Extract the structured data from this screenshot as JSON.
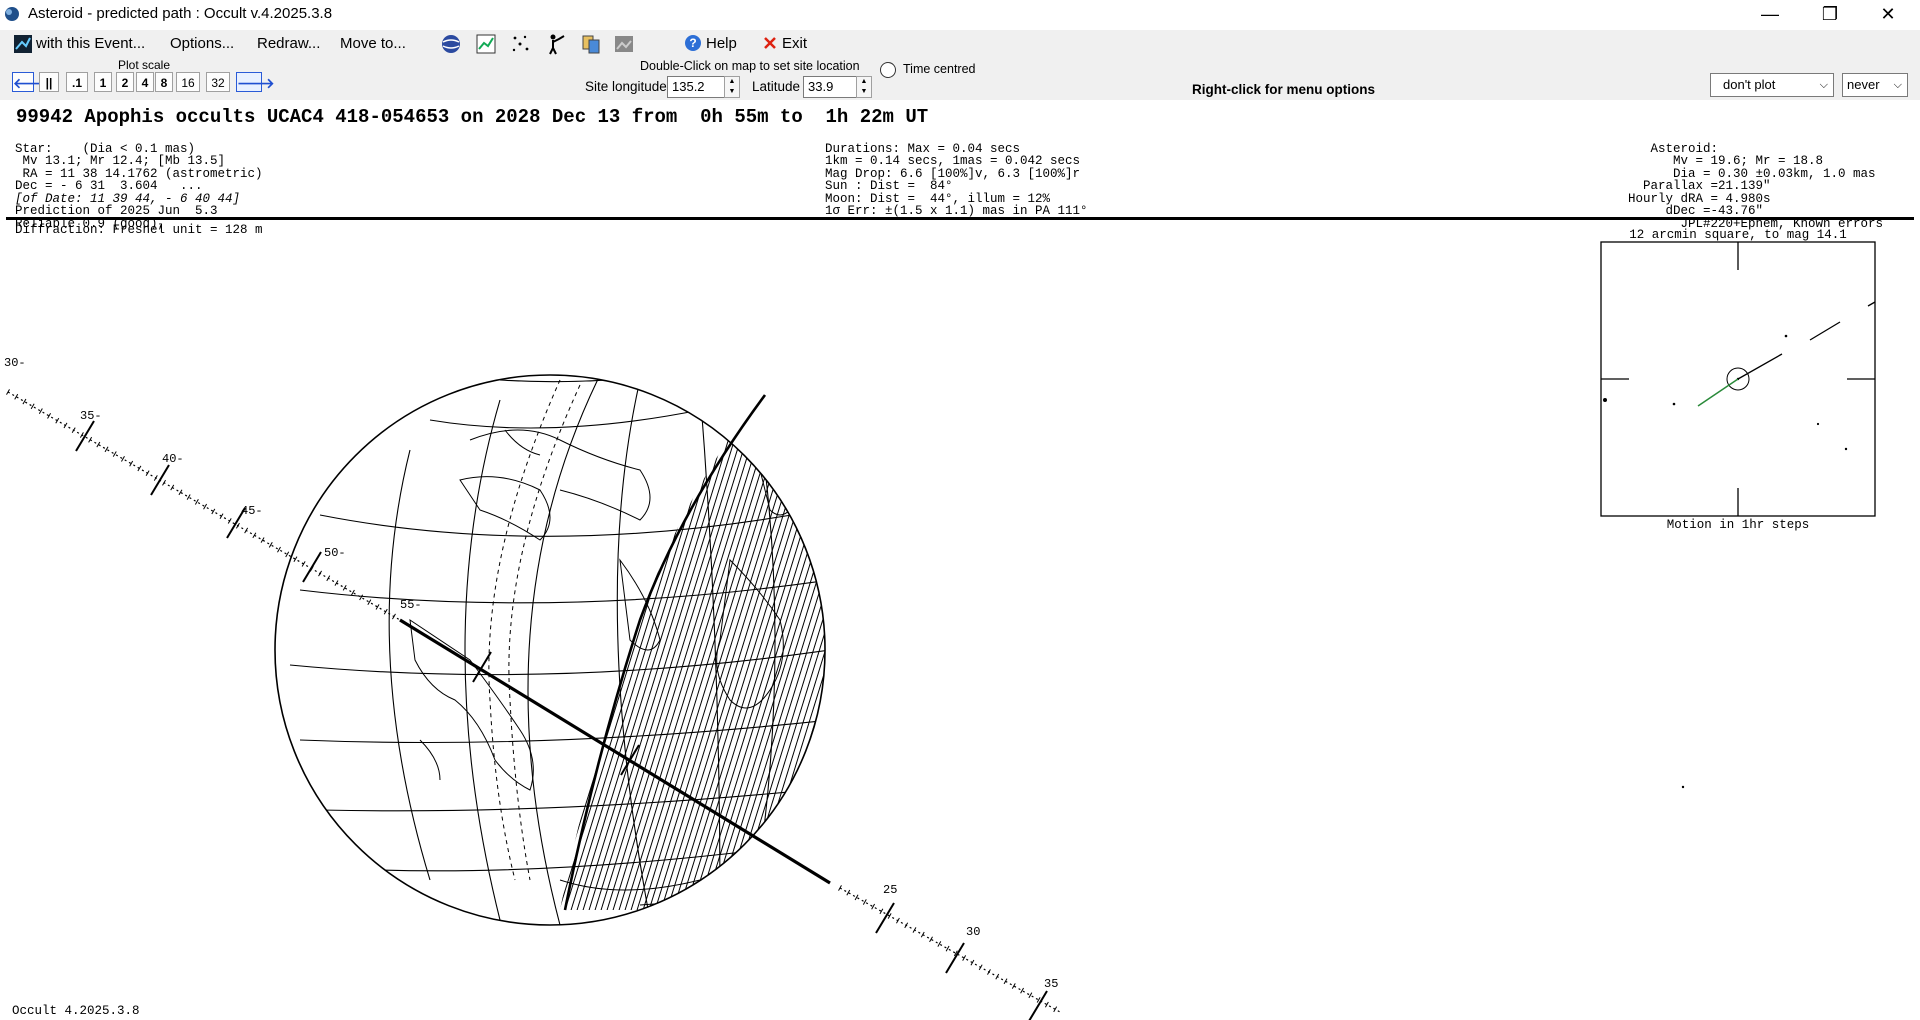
{
  "window": {
    "title": "Asteroid - predicted path : Occult v.4.2025.3.8",
    "controls": [
      "—",
      "❐",
      "✕"
    ]
  },
  "menu": {
    "with_event": "with this Event...",
    "options": "Options...",
    "redraw": "Redraw...",
    "move_to": "Move to...",
    "help": "Help",
    "exit": "Exit"
  },
  "plot_scale": {
    "label": "Plot scale",
    "buttons": [
      ".1",
      "1",
      "2",
      "4",
      "8",
      "16",
      "32"
    ]
  },
  "site": {
    "hint": "Double-Click on map to set site location",
    "time_centred": "Time centred",
    "longitude_label": "Site longitude",
    "longitude_value": "135.2",
    "latitude_label": "Latitude",
    "latitude_value": "33.9"
  },
  "right_click_hint": "Right-click for menu options",
  "dropdowns": {
    "plot": "don't plot",
    "when": "never"
  },
  "event": {
    "headline": "99942 Apophis occults UCAC4 418-054653 on 2028 Dec 13 from  0h 55m to  1h 22m UT",
    "star_lines": [
      "Star:    (Dia < 0.1 mas)",
      " Mv 13.1; Mr 12.4; [Mb 13.5]",
      " RA = 11 38 14.1762 (astrometric)",
      "Dec = - 6 31  3.604   ...",
      "[of Date: 11 39 44, - 6 40 44]",
      "Prediction of 2025 Jun  5.3",
      "Reliable 0.9 (good),"
    ],
    "mid_lines": [
      "Durations: Max = 0.04 secs",
      "1km = 0.14 secs, 1mas = 0.042 secs",
      "Mag Drop: 6.6 [100%]v, 6.3 [100%]r",
      "Sun : Dist =  84°",
      "Moon: Dist =  44°, illum = 12%",
      "1σ Err: ±(1.5 x 1.1) mas in PA 111°"
    ],
    "asteroid_lines": [
      "   Asteroid:",
      "      Mv = 19.6; Mr = 18.8",
      "      Dia = 0.30 ±0.03km, 1.0 mas",
      "  Parallax =21.139\"",
      "Hourly dRA = 4.980s",
      "     dDec =-43.76\"",
      "       JPL#220+Ephem, Known errors"
    ]
  },
  "diffraction": "Diffraction: Fresnel unit = 128 m",
  "path_ticks": [
    "30-",
    "35-",
    "40-",
    "45-",
    "50-",
    "55-",
    "25",
    "30",
    "35"
  ],
  "inset": {
    "title": "12 arcmin square, to mag 14.1",
    "caption": "Motion in 1hr steps"
  },
  "status": "Occult 4.2025.3.8"
}
